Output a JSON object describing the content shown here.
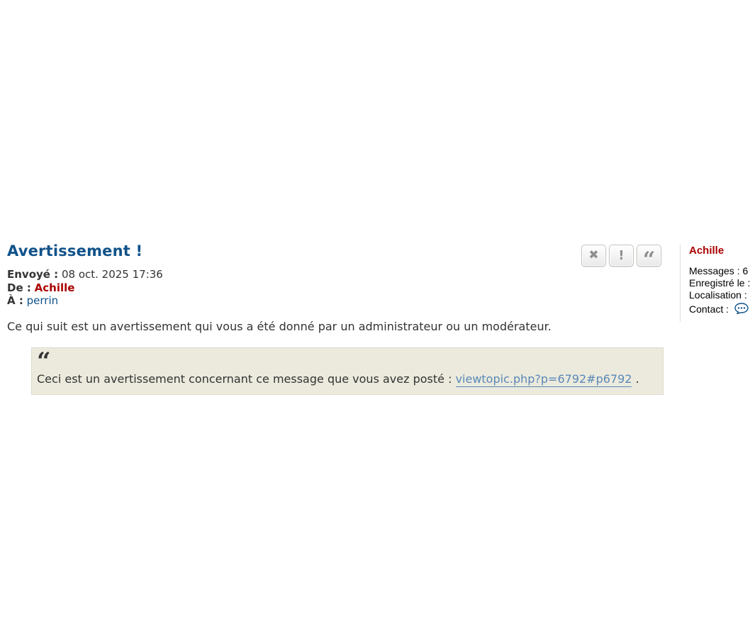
{
  "post": {
    "title": "Avertissement !",
    "sent_label": "Envoyé :",
    "sent_value": "08 oct. 2025 17:36",
    "from_label": "De :",
    "from_value": "Achille",
    "to_label": "À :",
    "to_value": "perrin",
    "body": "Ce qui suit est un avertissement qui vous a été donné par un administrateur ou un modérateur.",
    "quote_text": "Ceci est un avertissement concernant ce message que vous avez posté :",
    "quote_link": "viewtopic.php?p=6792#p6792",
    "quote_suffix": ".",
    "actions": {
      "delete_icon": "close-icon",
      "report_icon": "exclamation-icon",
      "quote_icon": "quote-icon"
    }
  },
  "profile": {
    "name": "Achille",
    "messages_label": "Messages :",
    "messages_value": "6",
    "registered_label": "Enregistré le :",
    "location_label": "Localisation :",
    "contact_label": "Contact :",
    "contact_icon": "speech-bubble-icon"
  },
  "colors": {
    "title": "#105289",
    "username": "#aa0000",
    "link": "#105289",
    "quote_bg": "#ebeadd"
  }
}
